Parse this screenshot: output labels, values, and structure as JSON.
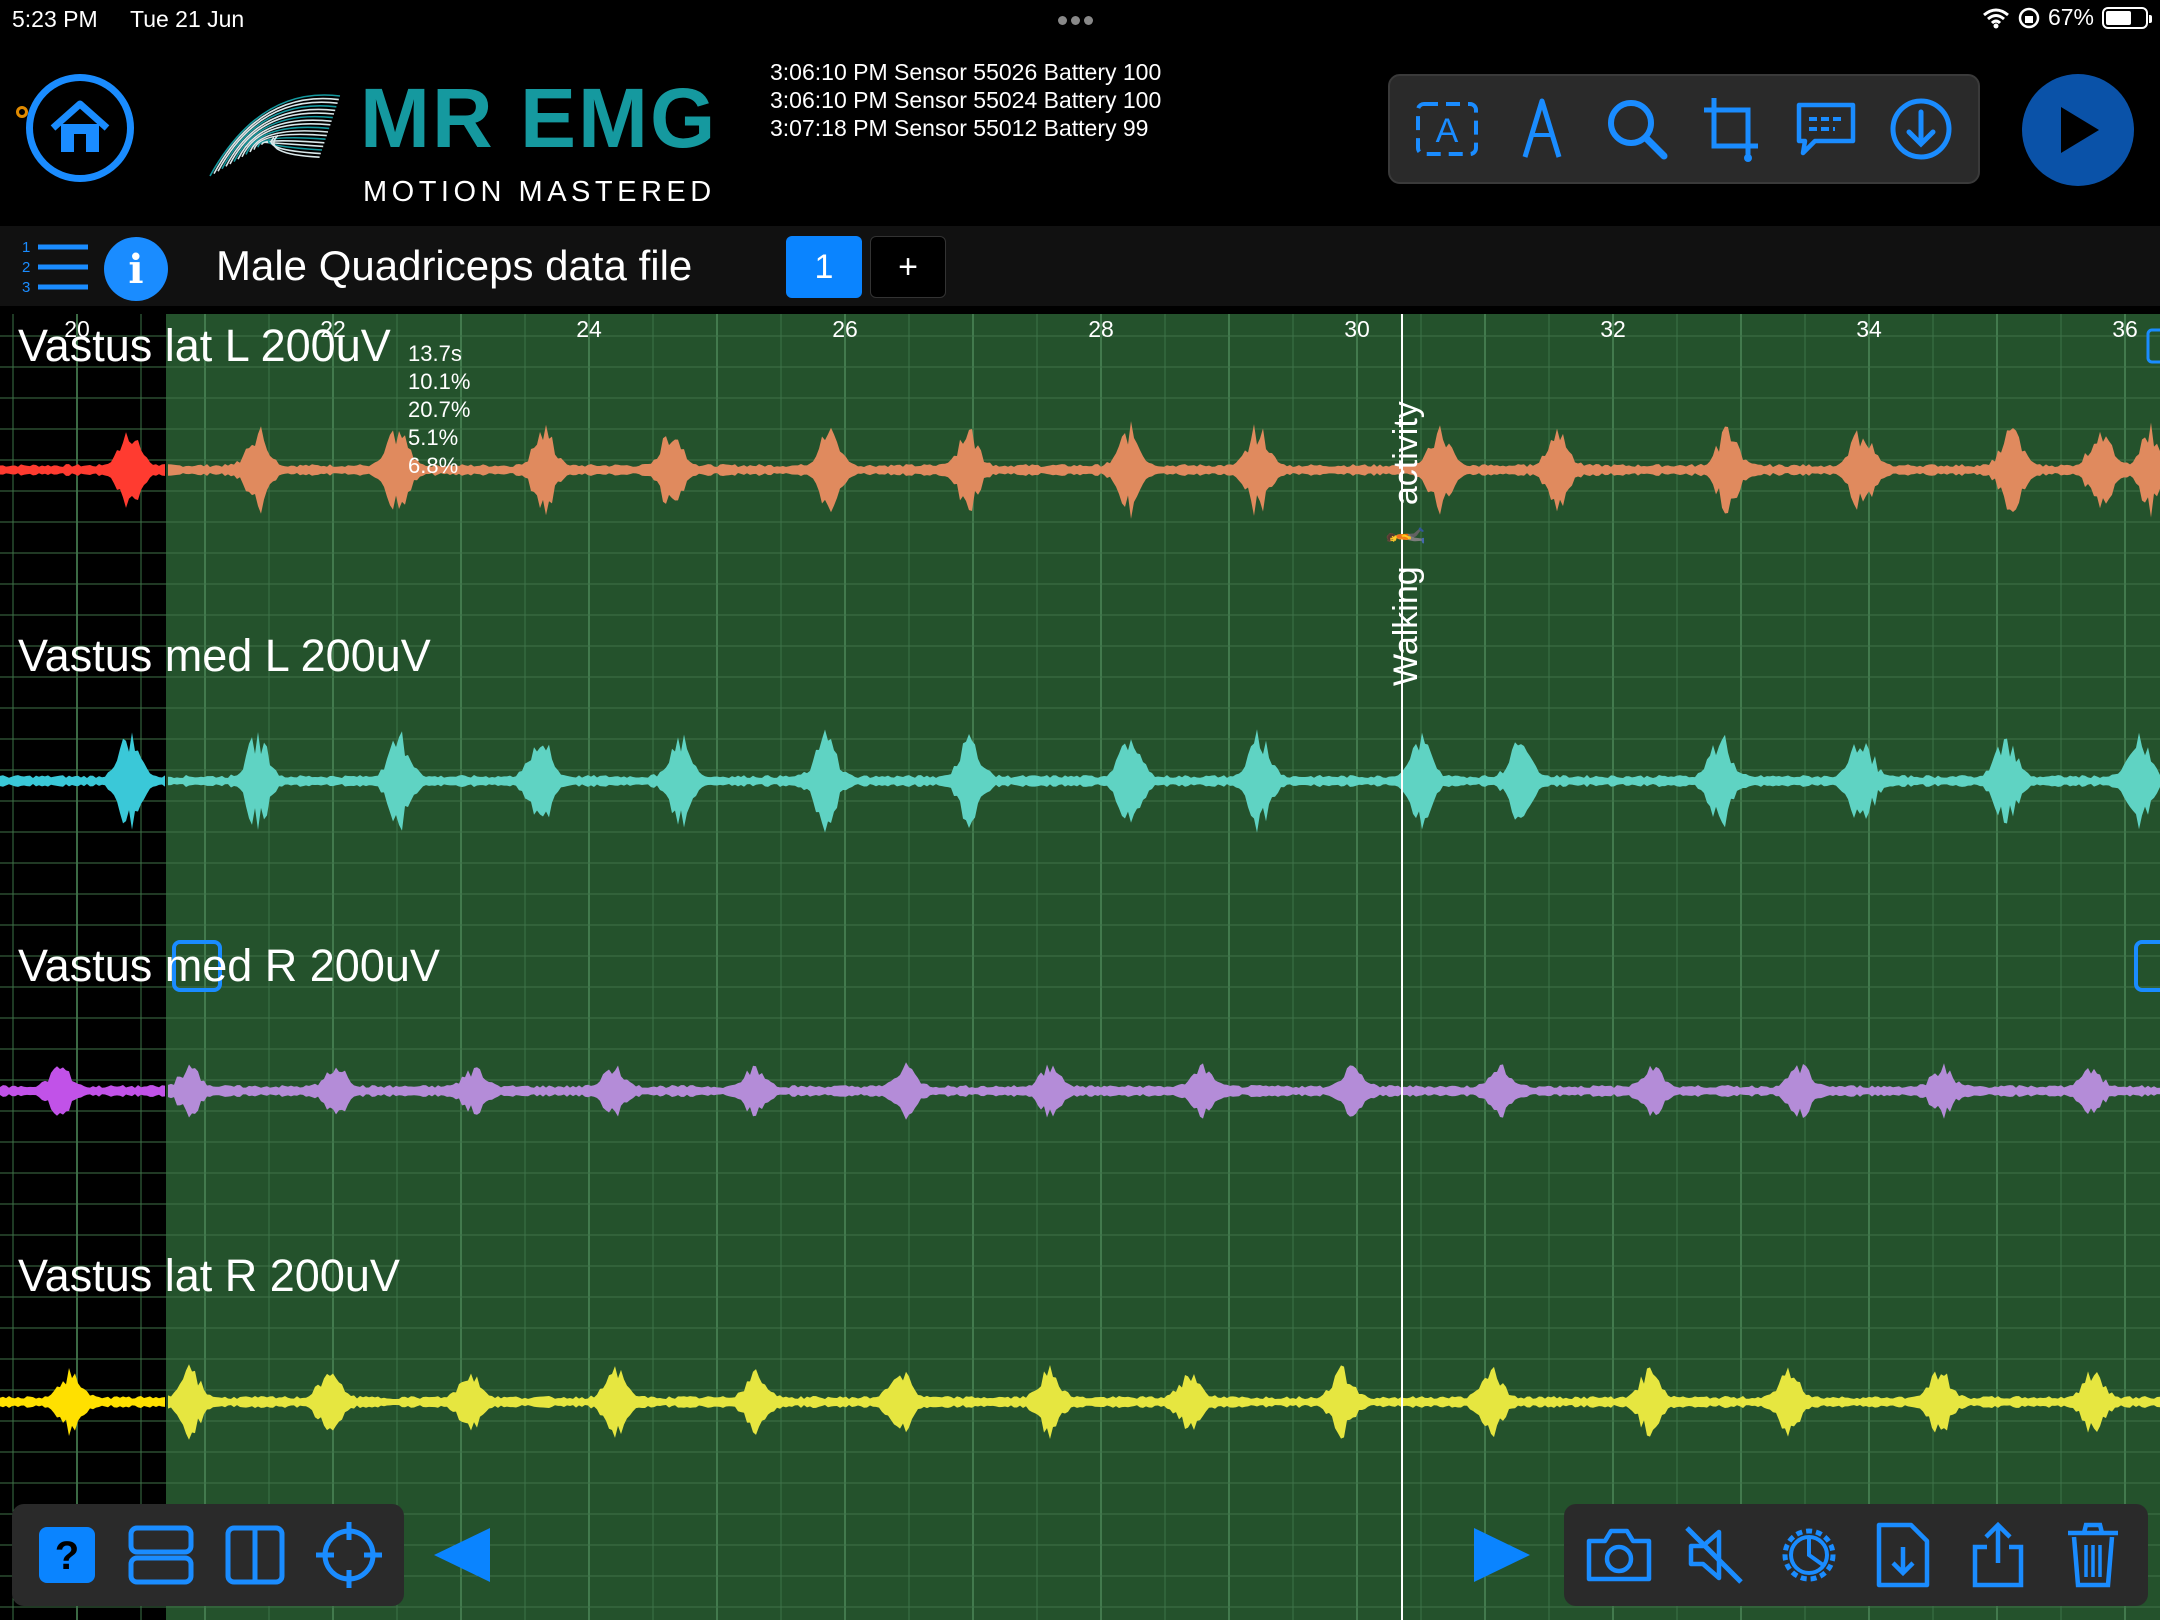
{
  "status_bar": {
    "time": "5:23 PM",
    "date": "Tue 21 Jun",
    "battery": "67%",
    "battery_level": 0.67
  },
  "brand": {
    "name": "MR EMG",
    "tagline": "MOTION MASTERED",
    "accent": "#15999f"
  },
  "sensor_log": [
    "3:06:10 PM Sensor 55026 Battery 100",
    "3:06:10 PM Sensor 55024 Battery 100",
    "3:07:18 PM Sensor 55012 Battery 99"
  ],
  "toolbar_top": [
    {
      "icon": "text-label-icon"
    },
    {
      "icon": "pen-tip-icon"
    },
    {
      "icon": "search-icon"
    },
    {
      "icon": "crop-icon"
    },
    {
      "icon": "comment-icon"
    },
    {
      "icon": "download-icon"
    }
  ],
  "file": {
    "title": "Male Quadriceps data file",
    "tabs": [
      "1",
      "+"
    ]
  },
  "plot": {
    "background": "#24522c",
    "x_ticks": [
      "20",
      "22",
      "24",
      "26",
      "28",
      "30",
      "32",
      "34",
      "36"
    ],
    "channels": [
      {
        "label": "Vastus lat L 200uV",
        "color": "#e08a5e",
        "lead_color": "#ff3b30"
      },
      {
        "label": "Vastus med L 200uV",
        "color": "#5fd3c3",
        "lead_color": "#3ac8d8"
      },
      {
        "label": "Vastus med R 200uV",
        "color": "#b48cd8",
        "lead_color": "#c152e8"
      },
      {
        "label": "Vastus lat R 200uV",
        "color": "#e6e640",
        "lead_color": "#ffe000"
      }
    ],
    "stats": [
      "13.7s",
      "10.1%",
      "20.7%",
      "5.1%",
      "6.8%"
    ],
    "annotation": "Walking 🚶 activity"
  },
  "toolbar_bottom_left": [
    {
      "icon": "help-icon"
    },
    {
      "icon": "stacked-layout-icon"
    },
    {
      "icon": "split-layout-icon"
    },
    {
      "icon": "crosshair-icon"
    }
  ],
  "toolbar_bottom_right": [
    {
      "icon": "camera-icon"
    },
    {
      "icon": "mute-icon"
    },
    {
      "icon": "settings-gear-icon"
    },
    {
      "icon": "file-import-icon"
    },
    {
      "icon": "share-icon"
    },
    {
      "icon": "trash-icon"
    }
  ]
}
